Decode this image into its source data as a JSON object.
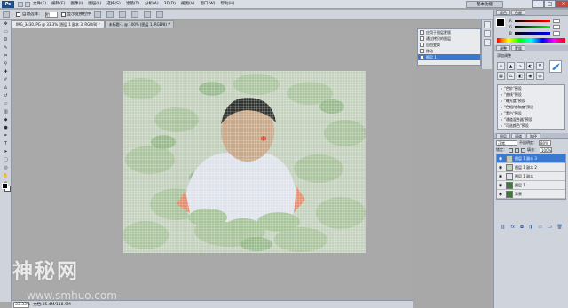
{
  "app": {
    "logo": "Ps",
    "essentials": "基本功能"
  },
  "menu": [
    "文件(F)",
    "编辑(E)",
    "图像(I)",
    "图层(L)",
    "选择(S)",
    "滤镜(T)",
    "分析(A)",
    "3D(D)",
    "视图(V)",
    "窗口(W)",
    "帮助(H)"
  ],
  "options": {
    "auto_select_label": "自动选择：",
    "auto_select_value": "组",
    "show_transform": "显示变换控件"
  },
  "tabs": [
    {
      "label": "IMG_3430.JPG @ 33.3% (图层 1 副本 3, RGB/8) *",
      "active": true
    },
    {
      "label": "未标题-1 @ 100% (图层 1, RGB/8) *",
      "active": false
    }
  ],
  "history": {
    "items": [
      {
        "label": "应用于图层蒙版",
        "selected": false
      },
      {
        "label": "通过拷贝的图层",
        "selected": false
      },
      {
        "label": "自由变换",
        "selected": false
      },
      {
        "label": "移动",
        "selected": false
      },
      {
        "label": "图层 1",
        "selected": true
      }
    ]
  },
  "color_panel": {
    "title": "颜色",
    "swatches": "色板",
    "r": "R",
    "g": "G",
    "b": "B",
    "r_val": "",
    "g_val": "",
    "b_val": ""
  },
  "adjustments": {
    "title": "调整",
    "masks": "蒙版",
    "add_label": "添加调整"
  },
  "styles_list": [
    "\"色阶\"预设",
    "\"曲线\"预设",
    "\"曝光度\"预设",
    "\"色相/饱和度\"预设",
    "\"黑白\"预设",
    "\"通道混合器\"预设",
    "\"可选颜色\"预设"
  ],
  "layers_panel": {
    "tabs": [
      "图层",
      "通道",
      "路径"
    ],
    "blend_mode": "正常",
    "opacity_label": "不透明度：",
    "opacity": "80%",
    "lock_label": "锁定：",
    "fill_label": "填充：",
    "fill": "100%",
    "layers": [
      {
        "name": "图层 1 副本 3",
        "selected": true
      },
      {
        "name": "图层 1 副本 2",
        "selected": false
      },
      {
        "name": "图层 1 副本",
        "selected": false
      },
      {
        "name": "图层 1",
        "selected": false
      },
      {
        "name": "背景",
        "selected": false
      }
    ]
  },
  "statusbar": {
    "zoom": "33.33%",
    "doc": "文档:35.4M/118.9M"
  },
  "watermark": {
    "main": "神秘网",
    "sub": "www.smhuo.com"
  },
  "colors": {
    "accent": "#3b78d0",
    "chrome": "#cfd4dc",
    "workspace": "#a9a9a9"
  }
}
